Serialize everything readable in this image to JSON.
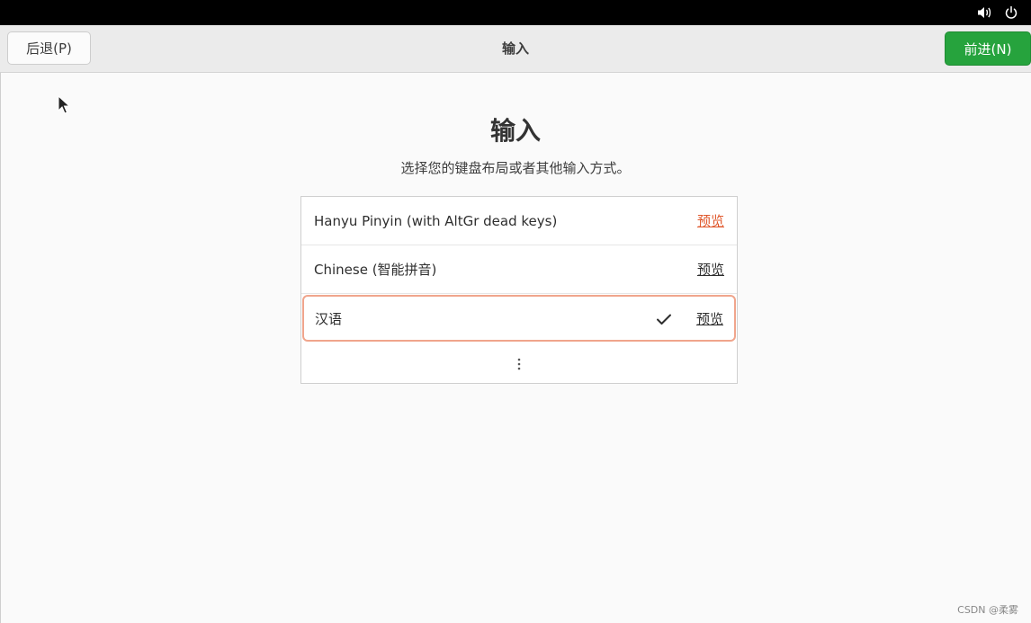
{
  "system_bar": {
    "icons": [
      "speaker-icon",
      "power-icon"
    ]
  },
  "header": {
    "back_label": "后退(P)",
    "title": "输入",
    "next_label": "前进(N)"
  },
  "page": {
    "title": "输入",
    "subtitle": "选择您的键盘布局或者其他输入方式。"
  },
  "input_methods": [
    {
      "label": "Hanyu Pinyin (with AltGr dead keys)",
      "preview_label": "预览",
      "selected": false
    },
    {
      "label": "Chinese (智能拼音)",
      "preview_label": "预览",
      "selected": false
    },
    {
      "label": "汉语",
      "preview_label": "预览",
      "selected": true
    }
  ],
  "more_icon": "more-options-icon",
  "watermark": "CSDN @柔雾",
  "colors": {
    "accent_green": "#26a33d",
    "selection_border": "#f0a58c",
    "link_hover": "#e0582c"
  }
}
